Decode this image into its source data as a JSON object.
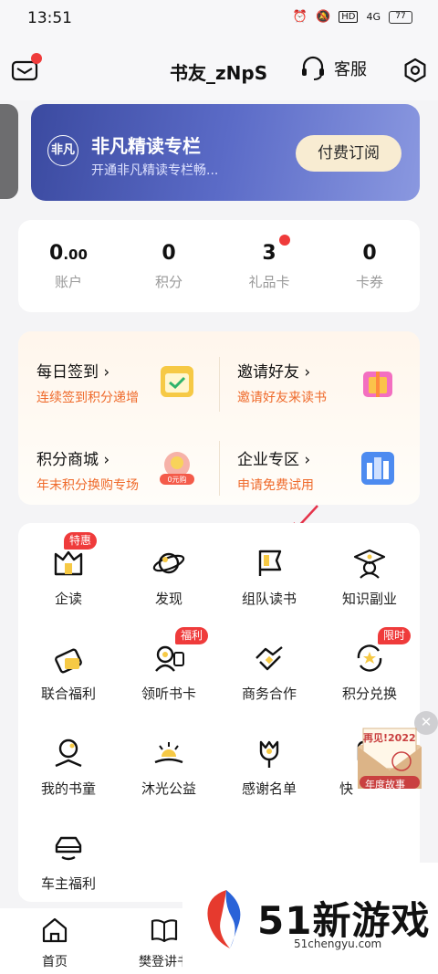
{
  "status": {
    "time": "13:51",
    "network": "4G",
    "battery": "77"
  },
  "header": {
    "user_name": "书友_zNpS",
    "service_label": "客服"
  },
  "vip": {
    "logo": "非凡",
    "title": "非凡精读专栏",
    "subtitle": "开通非凡精读专栏畅...",
    "button": "付费订阅"
  },
  "stats": [
    {
      "value_int": "0",
      "value_dec": ".00",
      "label": "账户"
    },
    {
      "value_int": "0",
      "value_dec": "",
      "label": "积分"
    },
    {
      "value_int": "3",
      "value_dec": "",
      "label": "礼品卡"
    },
    {
      "value_int": "0",
      "value_dec": "",
      "label": "卡券"
    }
  ],
  "promos": [
    {
      "title": "每日签到 ›",
      "subtitle": "连续签到积分递增",
      "icon": "calendar-check-icon",
      "color": "#f6c945"
    },
    {
      "title": "邀请好友 ›",
      "subtitle": "邀请好友来读书",
      "icon": "gift-box-icon",
      "color": "#f36fc0"
    },
    {
      "title": "积分商城 ›",
      "subtitle": "年末积分换购专场",
      "icon": "zero-yuan-coupon-icon",
      "color": "#f46b5a"
    },
    {
      "title": "企业专区 ›",
      "subtitle": "申请免费试用",
      "icon": "enterprise-building-icon",
      "color": "#4d8bf0"
    }
  ],
  "grid": [
    {
      "label": "企读",
      "badge": "特惠",
      "icon": "enterprise-read-icon"
    },
    {
      "label": "发现",
      "badge": "",
      "icon": "planet-icon"
    },
    {
      "label": "组队读书",
      "badge": "",
      "icon": "team-flag-icon"
    },
    {
      "label": "知识副业",
      "badge": "",
      "icon": "graduate-cap-icon"
    },
    {
      "label": "联合福利",
      "badge": "",
      "icon": "coupon-stack-icon"
    },
    {
      "label": "领听书卡",
      "badge": "福利",
      "icon": "listening-card-icon"
    },
    {
      "label": "商务合作",
      "badge": "",
      "icon": "handshake-icon"
    },
    {
      "label": "积分兑换",
      "badge": "限时",
      "icon": "points-exchange-icon"
    },
    {
      "label": "我的书童",
      "badge": "",
      "icon": "book-assistant-icon"
    },
    {
      "label": "沐光公益",
      "badge": "",
      "icon": "sunrise-book-icon"
    },
    {
      "label": "感谢名单",
      "badge": "",
      "icon": "tulip-icon"
    },
    {
      "label": "快",
      "badge": "",
      "icon": "quick-icon"
    },
    {
      "label": "车主福利",
      "badge": "",
      "icon": "car-icon"
    }
  ],
  "float_ad": {
    "line1": "再见!2022",
    "line2": "年度故事"
  },
  "tabs": [
    {
      "label": "首页"
    },
    {
      "label": "樊登讲书"
    }
  ],
  "watermark": {
    "title": "51新游戏",
    "site": "51chengyu.com"
  }
}
